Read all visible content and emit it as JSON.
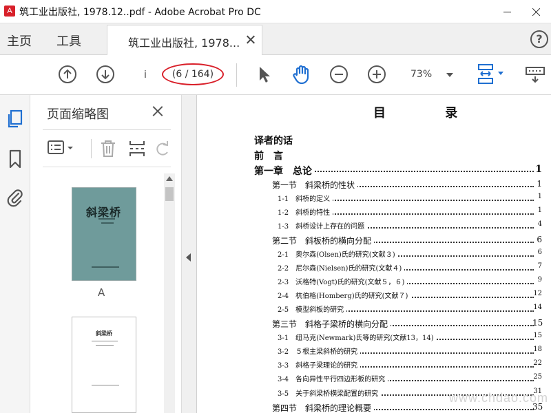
{
  "window": {
    "title": "筑工业出版社, 1978.12..pdf - Adobe Acrobat Pro DC"
  },
  "tabs": {
    "home": "主页",
    "tools": "工具",
    "document": "筑工业出版社, 1978..."
  },
  "toolbar": {
    "current_page": "i",
    "page_count": "(6 / 164)",
    "zoom": "73%"
  },
  "thumbnails": {
    "title": "页面缩略图",
    "items": [
      {
        "cover_title": "斜梁桥",
        "label": "A"
      },
      {
        "cover_title": "斜梁桥",
        "label": ""
      }
    ]
  },
  "toc": {
    "heading": "目 录",
    "entries": [
      {
        "text": "译者的话",
        "page": "",
        "level": 0
      },
      {
        "text": "前　言",
        "page": "",
        "level": 0
      },
      {
        "text": "第一章　总论",
        "page": "1",
        "level": 0
      },
      {
        "text": "第一节　斜梁桥的性状",
        "page": "1",
        "level": 1
      },
      {
        "text": "1-1　斜桥的定义",
        "page": "1",
        "level": 2
      },
      {
        "text": "1-2　斜桥的特性",
        "page": "1",
        "level": 2
      },
      {
        "text": "1-3　斜桥设计上存在的问题",
        "page": "4",
        "level": 2
      },
      {
        "text": "第二节　斜板桥的横向分配",
        "page": "6",
        "level": 1
      },
      {
        "text": "2-1　奥尔森(Olsen)氏的研究(文献３)",
        "page": "6",
        "level": 2
      },
      {
        "text": "2-2　尼尔森(Nielsen)氏的研究(文献４)",
        "page": "7",
        "level": 2
      },
      {
        "text": "2-3　沃格特(Vogt)氏的研究(文献５，６)",
        "page": "9",
        "level": 2
      },
      {
        "text": "2-4　杭伯格(Homberg)氏的研究(文献７)",
        "page": "12",
        "level": 2
      },
      {
        "text": "2-5　模型斜板的研究",
        "page": "14",
        "level": 2
      },
      {
        "text": "第三节　斜格子梁桥的横向分配",
        "page": "15",
        "level": 1
      },
      {
        "text": "3-1　纽马克(Newmark)氏等的研究(文献13，14)",
        "page": "15",
        "level": 2
      },
      {
        "text": "3-2　５根主梁斜桥的研究",
        "page": "18",
        "level": 2
      },
      {
        "text": "3-3　斜格子梁理论的研究",
        "page": "22",
        "level": 2
      },
      {
        "text": "3-4　各向异性平行四边形板的研究",
        "page": "25",
        "level": 2
      },
      {
        "text": "3-5　关于斜梁桥横梁配置的研究",
        "page": "31",
        "level": 2
      },
      {
        "text": "第四节　斜梁桥的理论概要",
        "page": "35",
        "level": 1
      }
    ]
  },
  "watermark": "www.chdao.com",
  "colors": {
    "highlight_circle": "#d9202a",
    "accent_blue": "#1f6fd1",
    "cover_teal": "#6f9b9b"
  }
}
